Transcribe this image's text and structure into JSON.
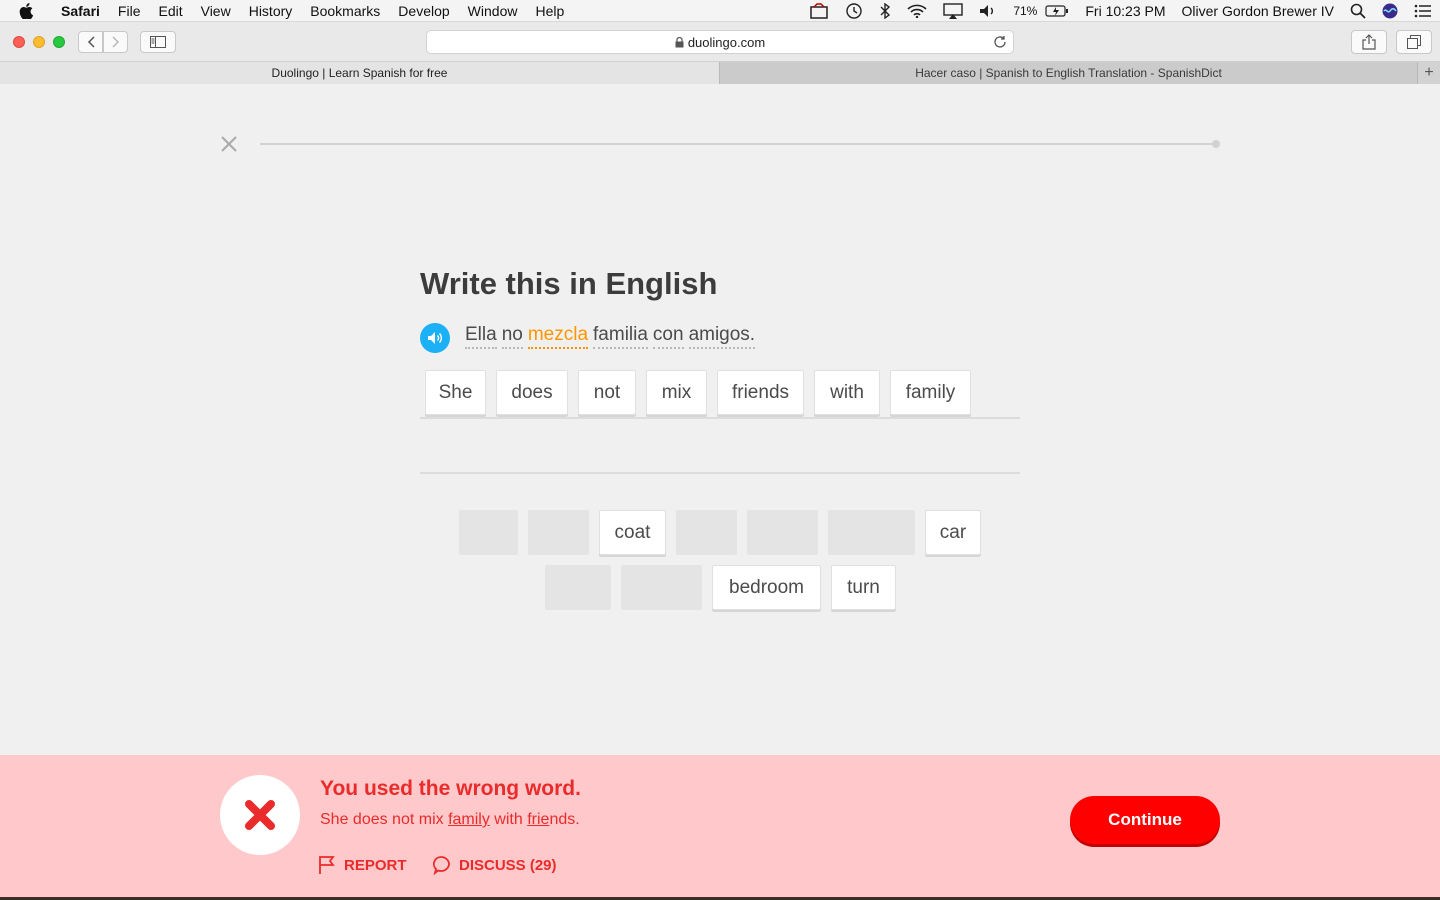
{
  "menubar": {
    "app": "Safari",
    "items": [
      "File",
      "Edit",
      "View",
      "History",
      "Bookmarks",
      "Develop",
      "Window",
      "Help"
    ],
    "battery": "71%",
    "datetime": "Fri 10:23 PM",
    "user": "Oliver Gordon Brewer IV"
  },
  "browser": {
    "url": "duolingo.com",
    "tabs": [
      {
        "title": "Duolingo | Learn Spanish for free",
        "active": true
      },
      {
        "title": "Hacer caso | Spanish to English Translation - SpanishDict",
        "active": false
      }
    ],
    "new_tab": "+"
  },
  "lesson": {
    "title": "Write this in English",
    "sentence": [
      "Ella",
      "no",
      "mezcla",
      "familia",
      "con",
      "amigos."
    ],
    "highlighted_word": "mezcla",
    "answer_tiles": [
      "She",
      "does",
      "not",
      "mix",
      "friends",
      "with",
      "family"
    ],
    "bank_row1": [
      "coat",
      "car"
    ],
    "bank_row2": [
      "bedroom",
      "turn"
    ],
    "progress": 0
  },
  "feedback": {
    "title": "You used the wrong word.",
    "answer_parts": [
      "She does not mix ",
      "family",
      " with ",
      "frie",
      "nds."
    ],
    "report_label": "REPORT",
    "discuss_label": "DISCUSS (29)",
    "continue_label": "Continue"
  },
  "colors": {
    "accent_blue": "#1cb0f6",
    "highlight_orange": "#ff9600",
    "error_red": "#ea2b2b",
    "error_bg": "#ffc9cb",
    "continue_red": "#ff0000"
  }
}
